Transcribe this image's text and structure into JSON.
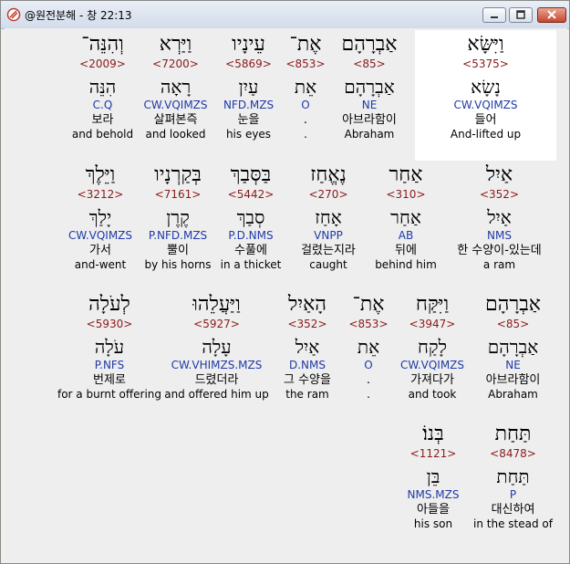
{
  "window": {
    "title": "@원전분해 - 창 22:13"
  },
  "rows": [
    {
      "words": [
        {
          "hebrew": "וַיִּשָּׂא",
          "strong": "<5375>",
          "lemma": "נָשָׂא",
          "parsing": "CW.VQIMZS",
          "korean": "들어",
          "english": "And-lifted up",
          "selected": true
        },
        {
          "hebrew": "אַבְרָהָם",
          "strong": "<85>",
          "lemma": "אַבְרָהָם",
          "parsing": "NE",
          "korean": "아브라함이",
          "english": "Abraham"
        },
        {
          "hebrew": "אֶת־",
          "strong": "<853>",
          "lemma": "אֵת",
          "parsing": "O",
          "korean": ".",
          "english": "."
        },
        {
          "hebrew": "עֵינָיו",
          "strong": "<5869>",
          "lemma": "עַיִן",
          "parsing": "NFD.MZS",
          "korean": "눈을",
          "english": "his eyes"
        },
        {
          "hebrew": "וַיַּרְא",
          "strong": "<7200>",
          "lemma": "רָאָה",
          "parsing": "CW.VQIMZS",
          "korean": "살펴본즉",
          "english": "and looked"
        },
        {
          "hebrew": "וְהִנֵּה־",
          "strong": "<2009>",
          "lemma": "הִנֵּה",
          "parsing": "C.Q",
          "korean": "보라",
          "english": "and behold"
        }
      ]
    },
    {
      "words": [
        {
          "hebrew": "אַיִל",
          "strong": "<352>",
          "lemma": "אַיִל",
          "parsing": "NMS",
          "korean": "한 수양이-있는데",
          "english": "a ram"
        },
        {
          "hebrew": "אַחַר",
          "strong": "<310>",
          "lemma": "אַחַר",
          "parsing": "AB",
          "korean": "뒤에",
          "english": "behind him"
        },
        {
          "hebrew": "נֶאֱחַז",
          "strong": "<270>",
          "lemma": "אָחַז",
          "parsing": "VNPP",
          "korean": "걸렸는지라",
          "english": "caught"
        },
        {
          "hebrew": "בַּסְּבַךְ",
          "strong": "<5442>",
          "lemma": "סְבַךְ",
          "parsing": "P.D.NMS",
          "korean": "수풀에",
          "english": "in a thicket"
        },
        {
          "hebrew": "בְּקַרְנָיו",
          "strong": "<7161>",
          "lemma": "קֶרֶן",
          "parsing": "P.NFD.MZS",
          "korean": "뿔이",
          "english": "by his horns"
        },
        {
          "hebrew": "וַיֵּלֶךְ",
          "strong": "<3212>",
          "lemma": "יָלַךְ",
          "parsing": "CW.VQIMZS",
          "korean": "가서",
          "english": "and-went"
        }
      ]
    },
    {
      "words": [
        {
          "hebrew": "אַבְרָהָם",
          "strong": "<85>",
          "lemma": "אַבְרָהָם",
          "parsing": "NE",
          "korean": "아브라함이",
          "english": "Abraham"
        },
        {
          "hebrew": "וַיִּקַּח",
          "strong": "<3947>",
          "lemma": "לָקַח",
          "parsing": "CW.VQIMZS",
          "korean": "가져다가",
          "english": "and took"
        },
        {
          "hebrew": "אֶת־",
          "strong": "<853>",
          "lemma": "אֵת",
          "parsing": "O",
          "korean": ".",
          "english": "."
        },
        {
          "hebrew": "הָאַיִל",
          "strong": "<352>",
          "lemma": "אַיִל",
          "parsing": "D.NMS",
          "korean": "그 수양을",
          "english": "the ram"
        },
        {
          "hebrew": "וַיַּעֲלֵהוּ",
          "strong": "<5927>",
          "lemma": "עָלָה",
          "parsing": "CW.VHIMZS.MZS",
          "korean": "드렸더라",
          "english": "and offered him up"
        },
        {
          "hebrew": "לְעֹלָה",
          "strong": "<5930>",
          "lemma": "עֹלָה",
          "parsing": "P.NFS",
          "korean": "번제로",
          "english": "for a burnt offering"
        }
      ]
    },
    {
      "words": [
        {
          "hebrew": "תַּחַת",
          "strong": "<8478>",
          "lemma": "תַּחַת",
          "parsing": "P",
          "korean": "대신하여",
          "english": "in the stead of"
        },
        {
          "hebrew": "בְּנוֹ׃",
          "strong": "<1121>",
          "lemma": "בֵּן",
          "parsing": "NMS.MZS",
          "korean": "아들을",
          "english": "his son"
        }
      ]
    }
  ]
}
